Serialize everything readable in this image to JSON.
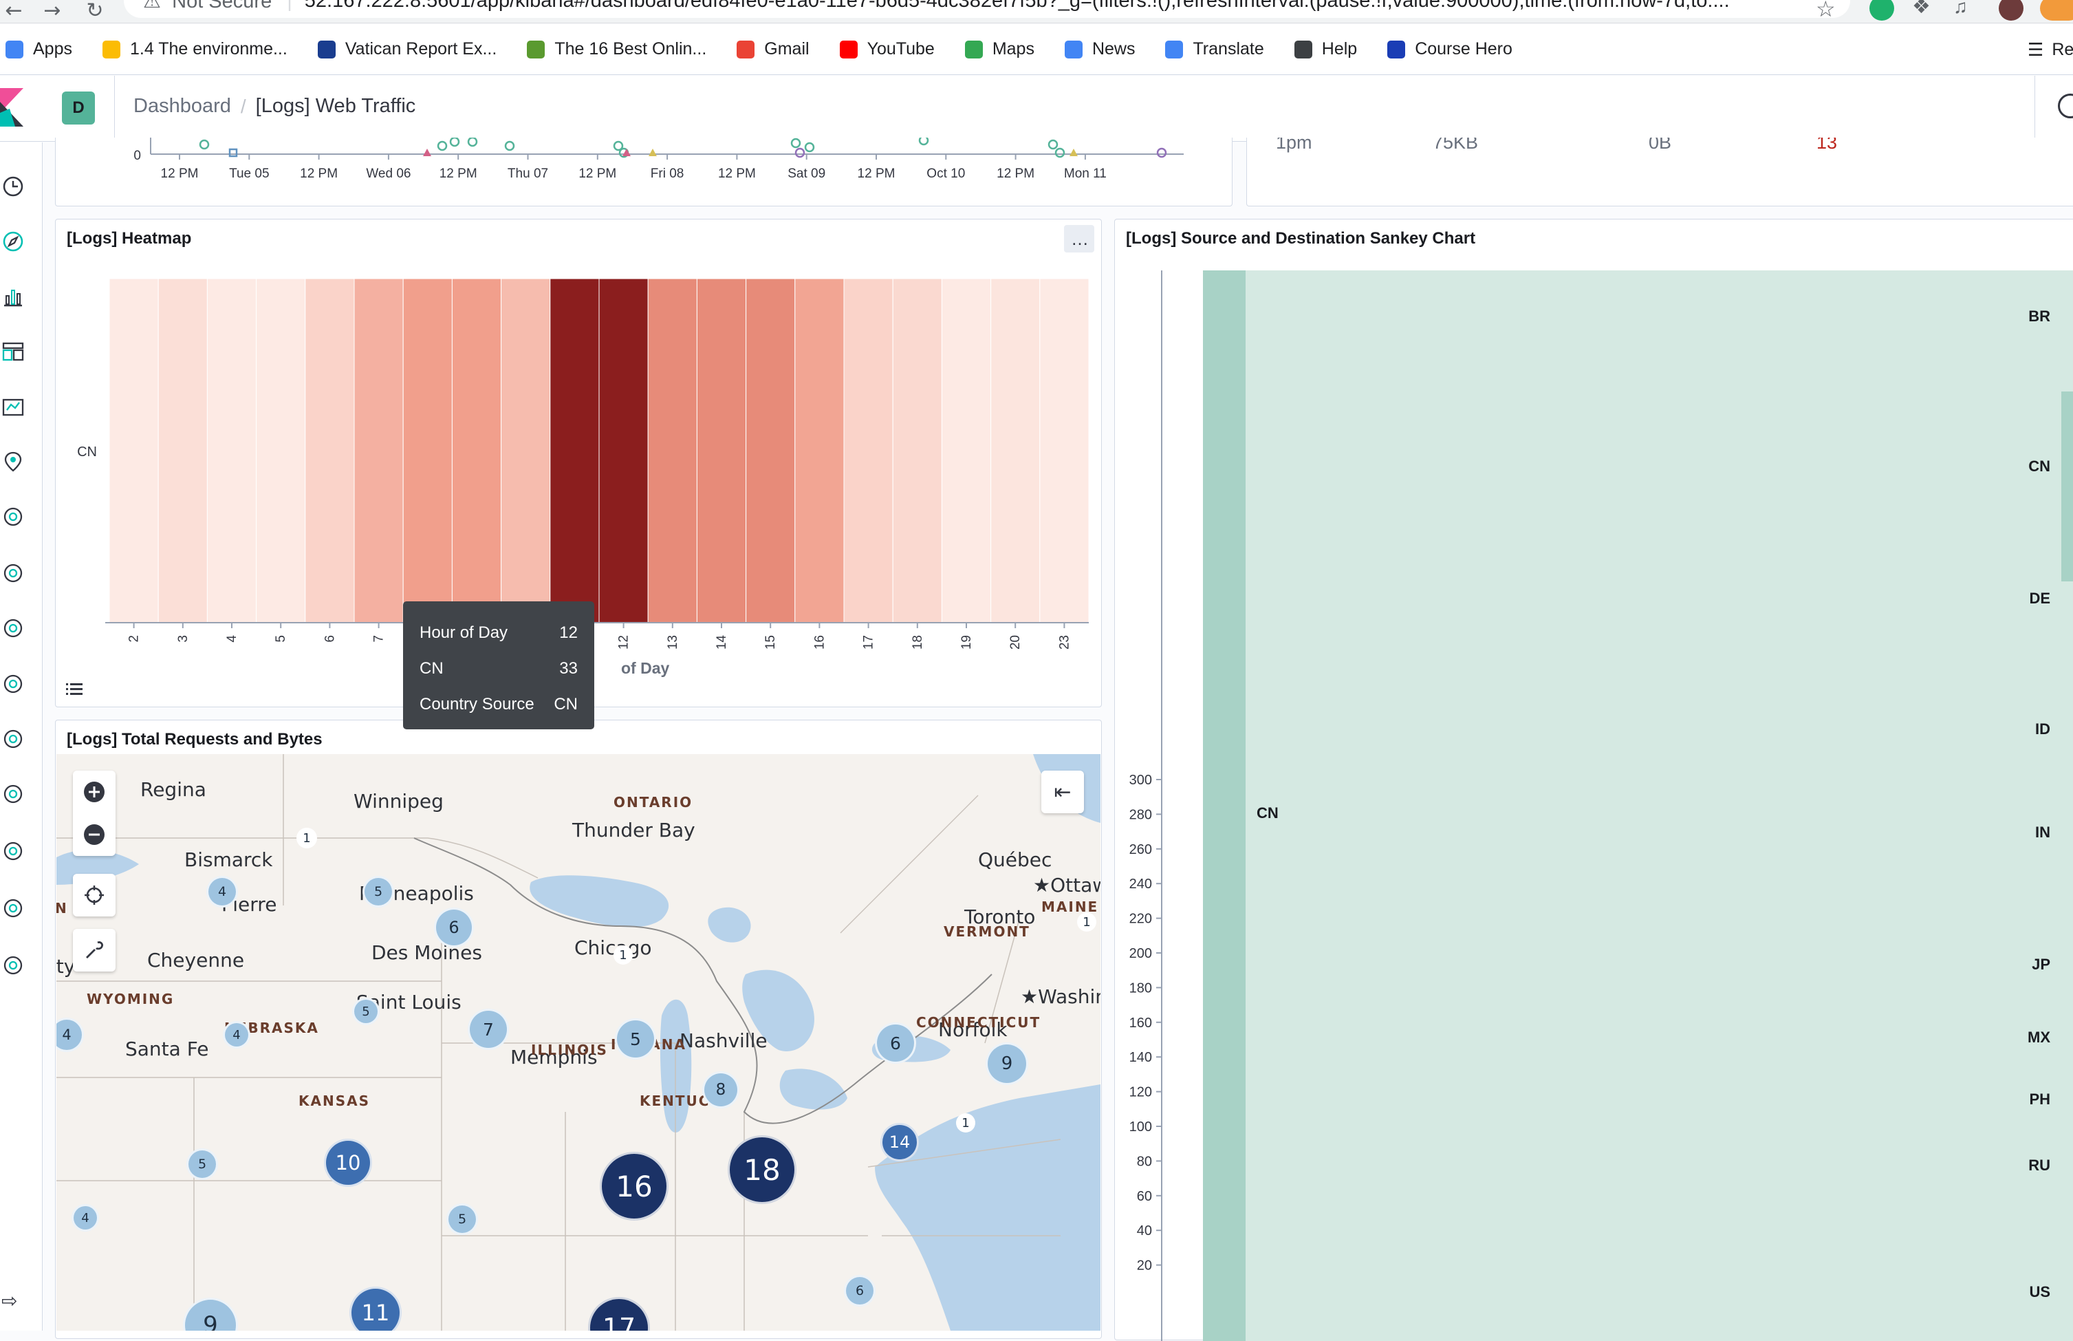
{
  "browser": {
    "security": "Not Secure",
    "url": "52.167.222.8:5601/app/kibana#/dashboard/edf84fe0-e1a0-11e7-b6d5-4dc382ef7f5b?_g=(filters:!(),refreshInterval:(pause:!f,value:900000),time:(from:now-7d,to:...",
    "bookmarks": [
      {
        "label": "Apps",
        "icon": "apps-grid-icon",
        "color": "#4285f4"
      },
      {
        "label": "1.4 The environme...",
        "icon": "bulb-icon",
        "color": "#fbbc04"
      },
      {
        "label": "Vatican Report Ex...",
        "icon": "news-icon",
        "color": "#1a3d8f"
      },
      {
        "label": "The 16 Best Onlin...",
        "icon": "bag-icon",
        "color": "#5a9a2f"
      },
      {
        "label": "Gmail",
        "icon": "gmail-icon",
        "color": "#ea4335"
      },
      {
        "label": "YouTube",
        "icon": "youtube-icon",
        "color": "#ff0000"
      },
      {
        "label": "Maps",
        "icon": "maps-icon",
        "color": "#34a853"
      },
      {
        "label": "News",
        "icon": "news-icon",
        "color": "#4285f4"
      },
      {
        "label": "Translate",
        "icon": "translate-icon",
        "color": "#4285f4"
      },
      {
        "label": "Help",
        "icon": "help-icon",
        "color": "#3c4043"
      },
      {
        "label": "Course Hero",
        "icon": "star-icon",
        "color": "#1a3db5"
      }
    ],
    "reading_list": "Re"
  },
  "header": {
    "space_initial": "D",
    "breadcrumb_root": "Dashboard",
    "breadcrumb_current": "[Logs] Web Traffic"
  },
  "top_panel": {
    "y_zero": "0",
    "ticks": [
      "12 PM",
      "Tue 05",
      "12 PM",
      "Wed 06",
      "12 PM",
      "Thu 07",
      "12 PM",
      "Fri 08",
      "12 PM",
      "Sat 09",
      "12 PM",
      "Oct 10",
      "12 PM",
      "Mon 11"
    ]
  },
  "top_right_panel": {
    "row": [
      "1pm",
      "75KB",
      "0B",
      "13"
    ]
  },
  "heatmap": {
    "title": "[Logs] Heatmap",
    "menu_label": "…",
    "chart_data": {
      "type": "heatmap",
      "title": "[Logs] Heatmap",
      "xlabel": "Hour of Day",
      "ylabel": "Country Source",
      "rows": [
        "CN"
      ],
      "columns": [
        "2",
        "3",
        "4",
        "5",
        "6",
        "7",
        "8",
        "9",
        "10",
        "11",
        "12",
        "13",
        "14",
        "15",
        "16",
        "17",
        "18",
        "19",
        "20",
        "23"
      ],
      "values": [
        [
          2,
          4,
          2,
          2,
          6,
          12,
          15,
          15,
          10,
          33,
          33,
          18,
          18,
          18,
          14,
          6,
          5,
          2,
          3,
          2
        ]
      ],
      "visible_ticks": [
        "2",
        "3",
        "4",
        "5",
        "6",
        "7",
        "12",
        "13",
        "14",
        "15",
        "16",
        "17",
        "18",
        "19",
        "20",
        "23"
      ]
    },
    "tooltip": {
      "rows": [
        {
          "key": "Hour of Day",
          "value": "12"
        },
        {
          "key": "CN",
          "value": "33"
        },
        {
          "key": "Country Source",
          "value": "CN"
        }
      ]
    },
    "axis_title_visible": "of Day"
  },
  "map": {
    "title": "[Logs] Total Requests and Bytes",
    "cities": [
      "Regina",
      "Winnipeg",
      "Thunder Bay",
      "Bismarck",
      "Québec",
      "Ottawa",
      "Minneapolis",
      "Pierre",
      "Toronto",
      "Chicago",
      "Des Moines",
      "Cheyenne",
      "Saint Louis",
      "Washington",
      "Norfolk",
      "Nashville",
      "Santa Fe",
      "Memphis",
      "ity"
    ],
    "regions": [
      "ONTARIO",
      "MAINE",
      "VERMONT",
      "WYOMING",
      "NEBRASKA",
      "CONNECTICUT",
      "ILLINOIS",
      "INDIANA",
      "KANSAS",
      "KENTUCKY"
    ],
    "clusters": [
      "1",
      "4",
      "5",
      "6",
      "1",
      "1",
      "5",
      "4",
      "4",
      "7",
      "5",
      "6",
      "9",
      "8",
      "14",
      "5",
      "10",
      "16",
      "18",
      "1",
      "5",
      "4",
      "6",
      "9",
      "11",
      "17"
    ],
    "partial_label": "N"
  },
  "sankey": {
    "title": "[Logs] Source and Destination Sankey Chart",
    "chart_data": {
      "type": "sankey",
      "title": "[Logs] Source and Destination Sankey Chart",
      "yticks": [
        20,
        40,
        60,
        80,
        100,
        120,
        140,
        160,
        180,
        200,
        220,
        240,
        260,
        280,
        300
      ],
      "source_nodes": [
        "CN"
      ],
      "dest_nodes": [
        "BR",
        "CN",
        "DE",
        "ID",
        "IN",
        "JP",
        "MX",
        "PH",
        "RU",
        "US"
      ]
    }
  },
  "colors": {
    "heat_max": "#8b1e1e",
    "cluster_dark": "#1b3266",
    "cluster_mid": "#3d6eb0",
    "cluster_light": "#9ec3e0",
    "sankey_node": "#a8d2c6",
    "sankey_link": "#d5e9e2",
    "water": "#b7d2ea"
  }
}
